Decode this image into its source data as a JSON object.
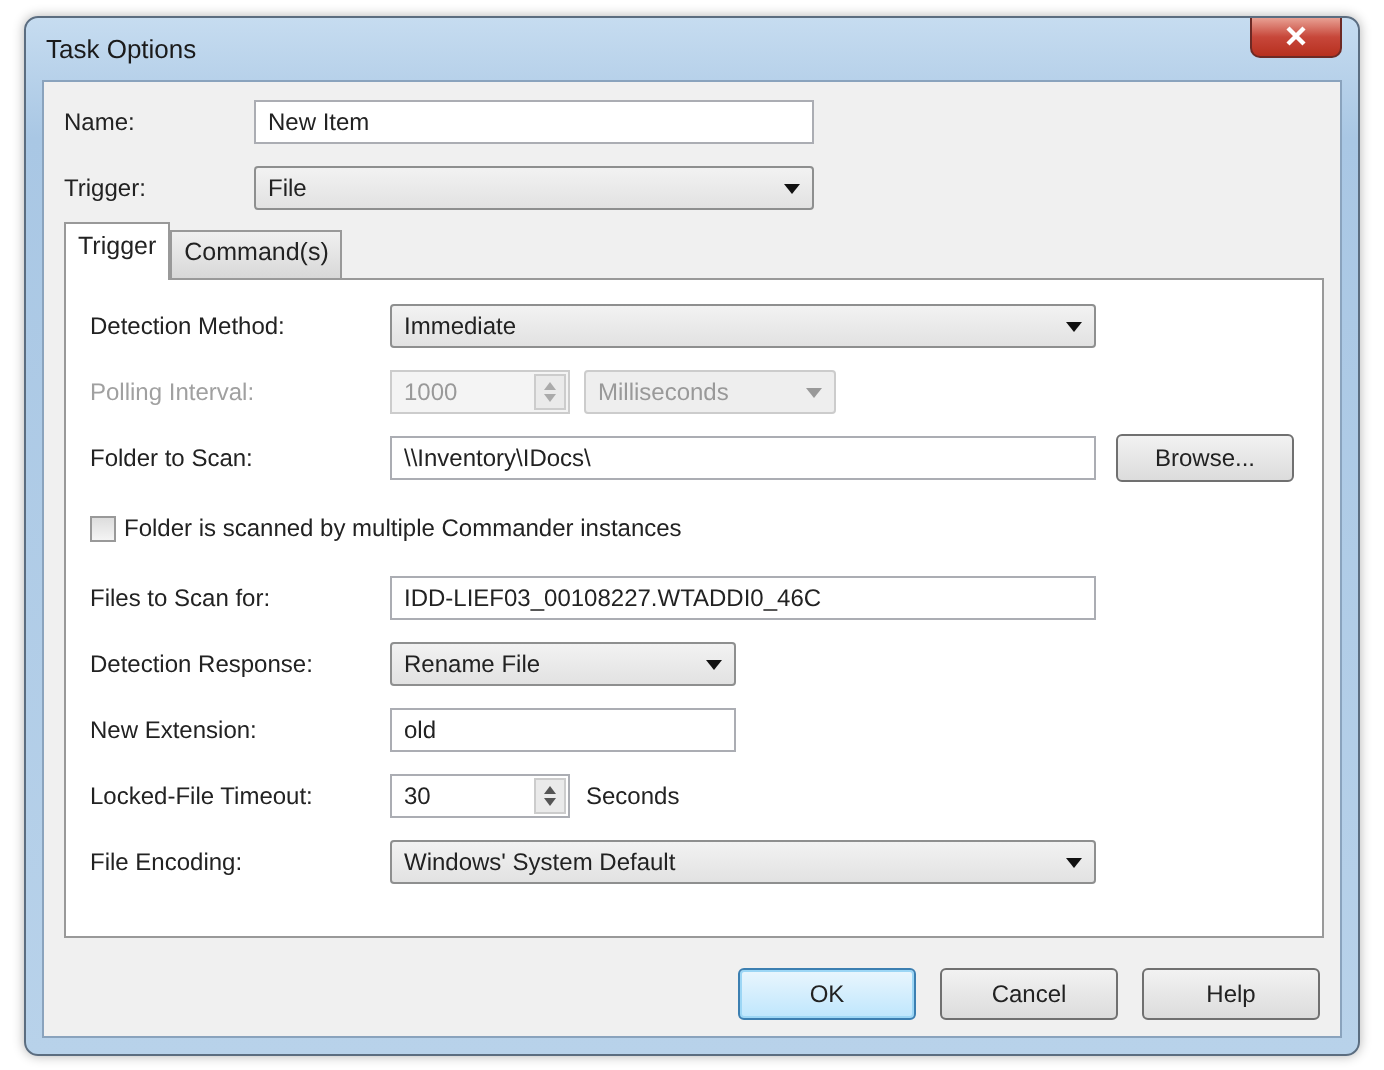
{
  "window": {
    "title": "Task Options"
  },
  "name_field": {
    "label": "Name:",
    "value": "New Item"
  },
  "trigger_field": {
    "label": "Trigger:",
    "value": "File"
  },
  "tabs": [
    {
      "label": "Trigger",
      "selected": true
    },
    {
      "label": "Command(s)",
      "selected": false
    }
  ],
  "rows": [
    {
      "kind": "dropdown",
      "label": "Detection Method:",
      "value": "Immediate",
      "disabled": false
    },
    {
      "kind": "spinner_dropdown",
      "label": "Polling Interval:",
      "value": "1000",
      "unit": "Milliseconds",
      "disabled": true
    },
    {
      "kind": "browse",
      "label": "Folder to Scan:",
      "value": "\\\\Inventory\\IDocs\\",
      "button": "Browse...",
      "disabled": false
    },
    {
      "kind": "checkbox",
      "label": "Folder is scanned by multiple Commander instances",
      "checked": false,
      "disabled": false
    },
    {
      "kind": "text",
      "label": "Files to Scan for:",
      "value": "IDD-LIEF03_00108227.WTADDI0_46C",
      "disabled": false
    },
    {
      "kind": "dropdown",
      "label": "Detection Response:",
      "value": "Rename File",
      "disabled": false
    },
    {
      "kind": "text",
      "label": "New Extension:",
      "value": "old",
      "disabled": false
    },
    {
      "kind": "spinner",
      "label": "Locked-File Timeout:",
      "value": "30",
      "unit": "Seconds",
      "disabled": false
    },
    {
      "kind": "dropdown",
      "label": "File Encoding:",
      "value": "Windows' System Default",
      "disabled": false
    }
  ],
  "buttons": [
    {
      "label": "OK",
      "default": true
    },
    {
      "label": "Cancel",
      "default": false
    },
    {
      "label": "Help",
      "default": false
    }
  ]
}
